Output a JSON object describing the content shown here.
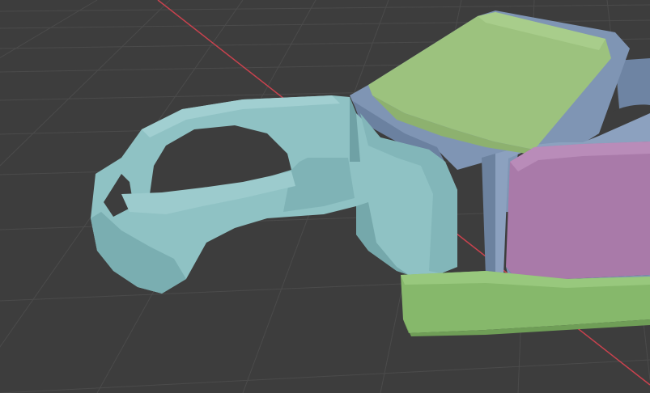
{
  "app": {
    "title": ""
  },
  "viewport": {
    "mode": "3D viewport",
    "shading": "solid",
    "background_color": "#3d3d3d",
    "grid_color": "#4b4b4b",
    "x_axis_color": "#c9424e",
    "object_colors": {
      "fender": "#8fc2c4",
      "fender_shadow": "#6fa1a5",
      "cabin_frame": "#7f95b4",
      "windshield": "#9cc27e",
      "door": "#a97aa9",
      "rocker_panel": "#86b86b"
    }
  }
}
